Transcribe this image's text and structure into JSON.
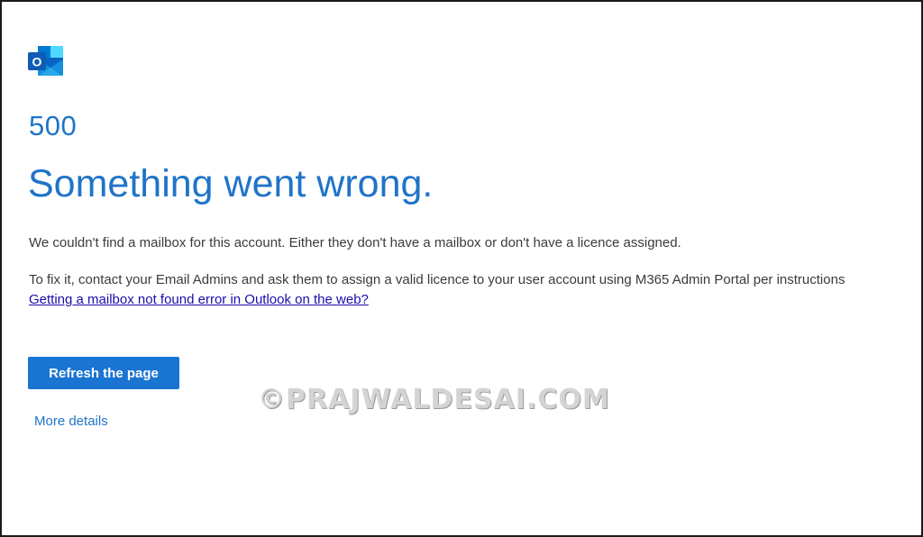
{
  "app": {
    "logo_icon": "outlook-logo-icon",
    "logo_letter": "O",
    "accent_color": "#1f74c8",
    "button_color": "#1a74d2"
  },
  "error": {
    "code": "500",
    "headline": "Something went wrong.",
    "message": "We couldn't find a mailbox for this account. Either they don't have a mailbox or don't have a licence assigned.",
    "instructions": "To fix it, contact your Email Admins and ask them to assign a valid licence to your user account using M365 Admin Portal per instructions",
    "help_link": "Getting a mailbox not found error in Outlook on the web?"
  },
  "actions": {
    "refresh_label": "Refresh the page",
    "details_label": "More details"
  },
  "watermark": {
    "text": "©PRAJWALDESAI.COM"
  }
}
